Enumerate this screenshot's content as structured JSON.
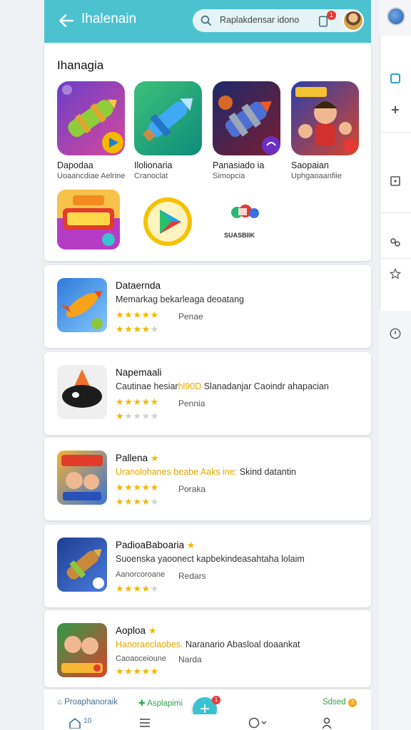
{
  "header": {
    "title": "Ihalenain",
    "search_text": "Raplakdensar idono",
    "notification_count": "1",
    "bg_color": "#4cc2cf"
  },
  "featured": {
    "section_title": "Ihanagia",
    "games": [
      {
        "name": "Dapodaa",
        "subtitle": "Uoaancdiae Aelrine"
      },
      {
        "name": "Ilolionaria",
        "subtitle": "Cranoclat"
      },
      {
        "name": "Panasiado ia",
        "subtitle": "Simopcia"
      },
      {
        "name": "Saopaian",
        "subtitle": "Uphgaoaanfiie"
      }
    ],
    "row2_label": "SUASBIIK"
  },
  "apps": [
    {
      "name": "Dataernda",
      "desc": "Memarkag bekarleaga deoatang",
      "desc_highlight": "",
      "desc_tail": "",
      "rating": 5,
      "rating_label": "Penae",
      "sub_rating": 4,
      "sub_label": ""
    },
    {
      "name": "Napemaali",
      "desc": "Cautinae hesiar",
      "desc_highlight": "hl90D",
      "desc_tail": " Slanadanjar Caoindr ahapacian",
      "rating": 5,
      "rating_label": "Pennia",
      "sub_rating": 1,
      "sub_label": ""
    },
    {
      "name": "Pallena",
      "desc": "",
      "desc_highlight": "Uranolohanes beabe Aaks ine:",
      "desc_tail": " Skind datantin",
      "rating": 5,
      "rating_label": "Poraka",
      "sub_rating": 4,
      "sub_label": ""
    },
    {
      "name": "PadioaBaboaria",
      "desc": "Suoenska yaoonect kapbekindeasahtaha lolaim",
      "desc_highlight": "",
      "desc_tail": "",
      "rating": 4,
      "rating_label": "Redars",
      "sub_rating": 0,
      "sub_label": "Aanorcoroane"
    },
    {
      "name": "Aoploa",
      "desc": "",
      "desc_highlight": "Hanoraeclaobes.",
      "desc_tail": " Naranario Abasloal doaankat",
      "rating": 5,
      "rating_label": "Narda",
      "sub_rating": 0,
      "sub_label": "Caoaoceioune"
    }
  ],
  "bottom_strip": {
    "left": "Proaphanoraik",
    "middle": "Asplapimi",
    "middle_badge": "1",
    "right": "Sdsed",
    "right_badge": "3"
  },
  "bottom_nav": {
    "home_label": "10"
  }
}
